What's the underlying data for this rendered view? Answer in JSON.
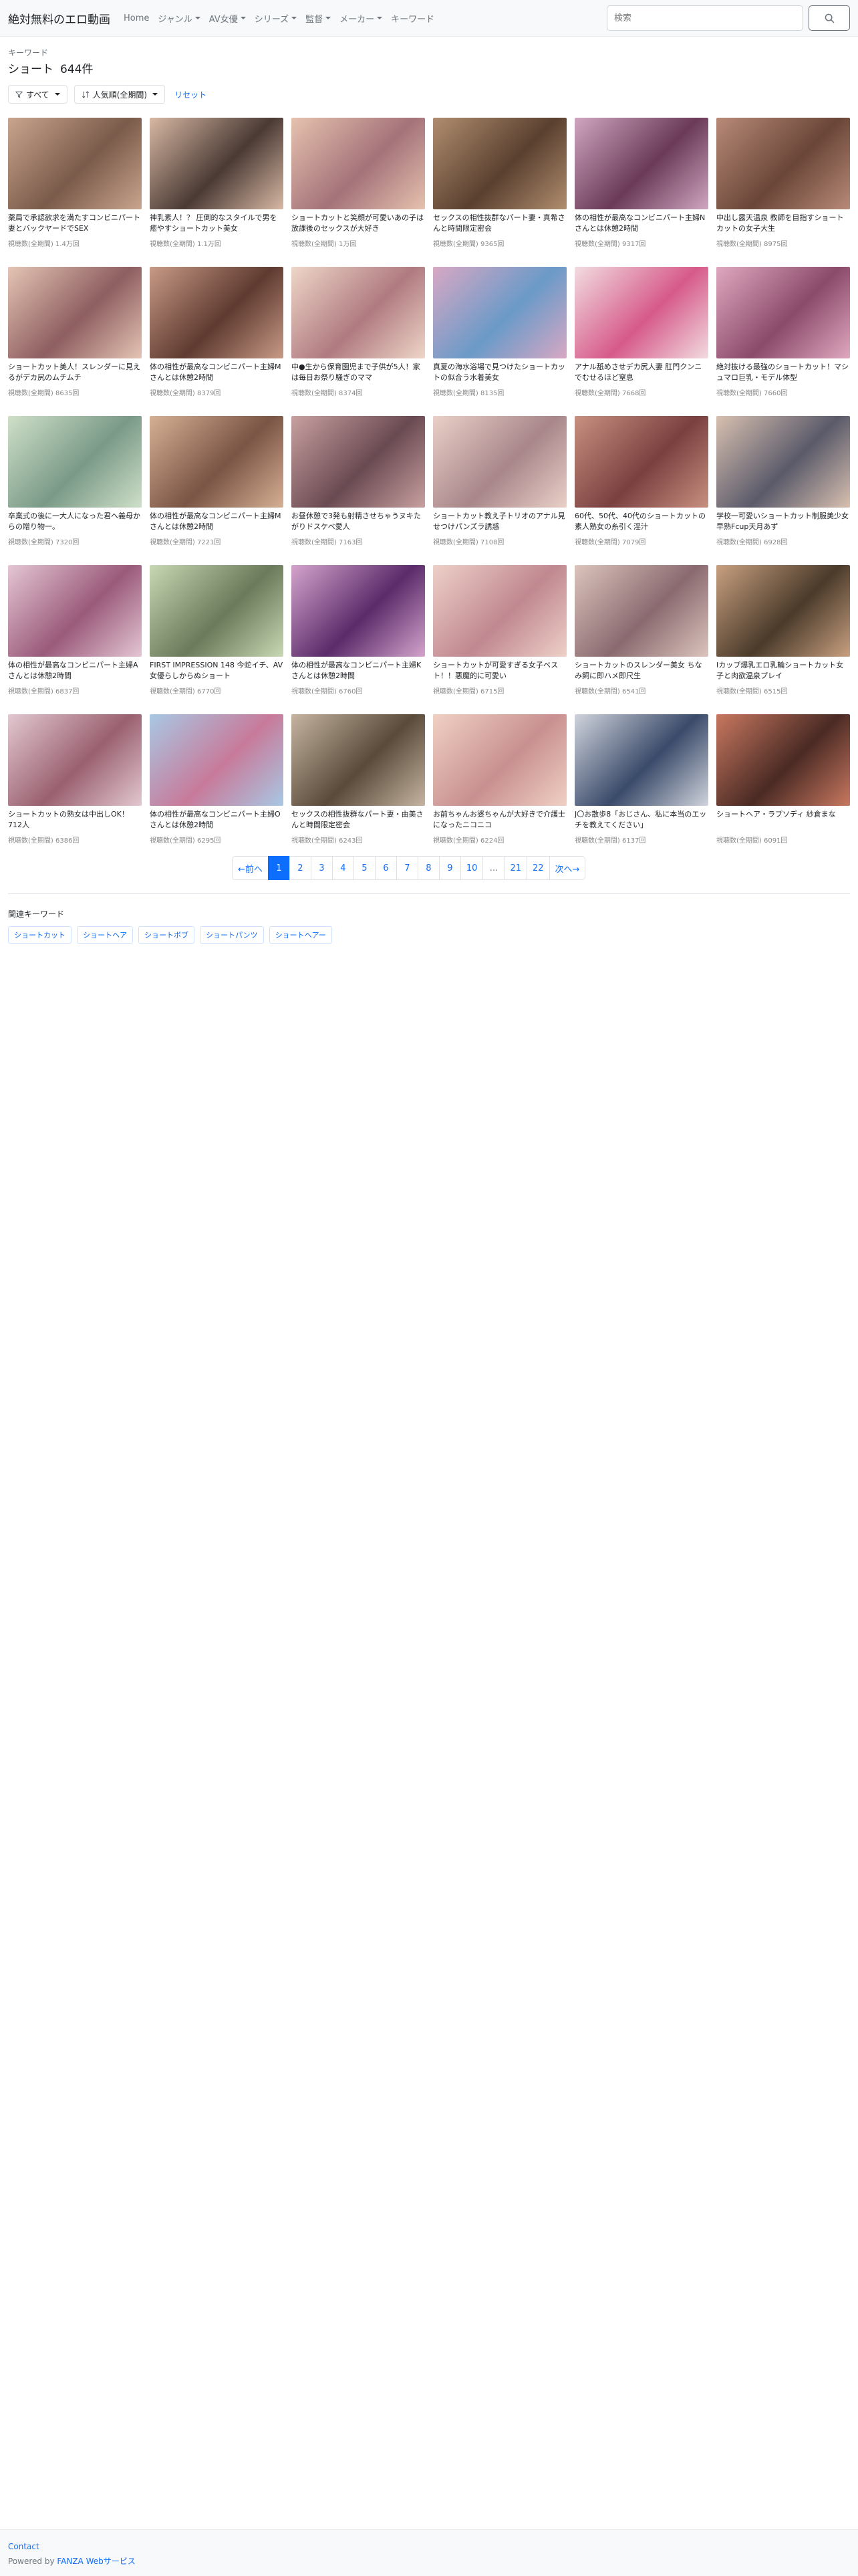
{
  "navbar": {
    "brand": "絶対無料のエロ動画",
    "items": [
      {
        "label": "Home",
        "dropdown": false
      },
      {
        "label": "ジャンル",
        "dropdown": true
      },
      {
        "label": "AV女優",
        "dropdown": true
      },
      {
        "label": "シリーズ",
        "dropdown": true
      },
      {
        "label": "監督",
        "dropdown": true
      },
      {
        "label": "メーカー",
        "dropdown": true
      },
      {
        "label": "キーワード",
        "dropdown": false
      }
    ],
    "search_placeholder": "検索"
  },
  "header": {
    "label": "キーワード",
    "title": "ショート",
    "count": "644件"
  },
  "filters": {
    "all_label": "すべて",
    "sort_label": "人気順(全期間)",
    "reset_label": "リセット"
  },
  "videos": [
    {
      "title": "薬局で承認欲求を満たすコンビニパート妻とバックヤードでSEX",
      "views": "視聴数(全期間) 1.4万回",
      "colors": [
        "#c9a58e",
        "#7a5a4a"
      ]
    },
    {
      "title": "神乳素人！？ 圧倒的なスタイルで男を癒やすショートカット美女",
      "views": "視聴数(全期間) 1.1万回",
      "colors": [
        "#d8b8a4",
        "#4a3a34"
      ]
    },
    {
      "title": "ショートカットと笑顔が可愛いあの子は放課後のセックスが大好き",
      "views": "視聴数(全期間) 1万回",
      "colors": [
        "#e6c2ae",
        "#a4727a"
      ]
    },
    {
      "title": "セックスの相性抜群なパート妻・真希さんと時間限定密会",
      "views": "視聴数(全期間) 9365回",
      "colors": [
        "#b08d6e",
        "#5a4030"
      ]
    },
    {
      "title": "体の相性が最高なコンビニパート主婦Nさんとは休憩2時間",
      "views": "視聴数(全期間) 9317回",
      "colors": [
        "#cfa6c0",
        "#6a3a58"
      ]
    },
    {
      "title": "中出し露天温泉 教師を目指すショートカットの女子大生",
      "views": "視聴数(全期間) 8975回",
      "colors": [
        "#b88a78",
        "#6a4638"
      ]
    },
    {
      "title": "ショートカット美人！スレンダーに見えるがデカ尻のムチムチ",
      "views": "視聴数(全期間) 8635回",
      "colors": [
        "#e4c4b4",
        "#8e5e60"
      ]
    },
    {
      "title": "体の相性が最高なコンビニパート主婦Mさんとは休憩2時間",
      "views": "視聴数(全期間) 8379回",
      "colors": [
        "#c89a86",
        "#5e3a30"
      ]
    },
    {
      "title": "中●生から保育園児まで子供が5人！家は毎日お祭り騒ぎのママ",
      "views": "視聴数(全期間) 8374回",
      "colors": [
        "#eed6c8",
        "#b07a80"
      ]
    },
    {
      "title": "真夏の海水浴場で見つけたショートカットの似合う水着美女",
      "views": "視聴数(全期間) 8135回",
      "colors": [
        "#d8a8c4",
        "#6a9ac8"
      ]
    },
    {
      "title": "アナル舐めさせデカ尻人妻 肛門クンニでむせるほど窒息",
      "views": "視聴数(全期間) 7668回",
      "colors": [
        "#f2dce0",
        "#d65a8a"
      ]
    },
    {
      "title": "絶対抜ける最強のショートカット！マシュマロ巨乳・モデル体型",
      "views": "視聴数(全期間) 7660回",
      "colors": [
        "#e0a8c0",
        "#8a4a6a"
      ]
    },
    {
      "title": "卒業式の後に一大人になった君へ義母からの贈り物一。",
      "views": "視聴数(全期間) 7320回",
      "colors": [
        "#cfe0c8",
        "#7a9a88"
      ]
    },
    {
      "title": "体の相性が最高なコンビニパート主婦Mさんとは休憩2時間",
      "views": "視聴数(全期間) 7221回",
      "colors": [
        "#d6b094",
        "#7a5444"
      ]
    },
    {
      "title": "お昼休憩で3発も射精させちゃうヌキたがりドスケベ愛人",
      "views": "視聴数(全期間) 7163回",
      "colors": [
        "#c8a0a0",
        "#6a4a52"
      ]
    },
    {
      "title": "ショートカット教え子トリオのアナル見せつけパンズラ誘惑",
      "views": "視聴数(全期間) 7108回",
      "colors": [
        "#ead0c8",
        "#a8868a"
      ]
    },
    {
      "title": "60代、50代、40代のショートカットの素人熟女の糸引く淫汁",
      "views": "視聴数(全期間) 7079回",
      "colors": [
        "#c89080",
        "#7a4040"
      ]
    },
    {
      "title": "学校一可愛いショートカット制服美少女 早熟Fcup天月あず",
      "views": "視聴数(全期間) 6928回",
      "colors": [
        "#d8c0b0",
        "#5a5a6a"
      ]
    },
    {
      "title": "体の相性が最高なコンビニパート主婦Aさんとは休憩2時間",
      "views": "視聴数(全期間) 6837回",
      "colors": [
        "#e4c6d4",
        "#9a5a7a"
      ]
    },
    {
      "title": "FIRST IMPRESSION 148 今蛇イチ、AV女優らしからぬショート",
      "views": "視聴数(全期間) 6770回",
      "colors": [
        "#c8d8b4",
        "#6a7a5a"
      ]
    },
    {
      "title": "体の相性が最高なコンビニパート主婦Kさんとは休憩2時間",
      "views": "視聴数(全期間) 6760回",
      "colors": [
        "#d4a4cc",
        "#5a2a6a"
      ]
    },
    {
      "title": "ショートカットが可愛すぎる女子ベスト！！悪魔的に可愛い",
      "views": "視聴数(全期間) 6715回",
      "colors": [
        "#eed0c8",
        "#c08890"
      ]
    },
    {
      "title": "ショートカットのスレンダー美女 ちなみ飼に即ハメ即尺生",
      "views": "視聴数(全期間) 6541回",
      "colors": [
        "#dcc4bc",
        "#8a6a70"
      ]
    },
    {
      "title": "Iカップ爆乳エロ乳輪ショートカット女子と肉欲温泉プレイ",
      "views": "視聴数(全期間) 6515回",
      "colors": [
        "#c8a080",
        "#4a3a2a"
      ]
    },
    {
      "title": "ショートカットの熟女は中出しOK！ 712人",
      "views": "視聴数(全期間) 6386回",
      "colors": [
        "#e2c8d0",
        "#9a6070"
      ]
    },
    {
      "title": "体の相性が最高なコンビニパート主婦Oさんとは休憩2時間",
      "views": "視聴数(全期間) 6295回",
      "colors": [
        "#a8c8e4",
        "#c87a9a"
      ]
    },
    {
      "title": "セックスの相性抜群なパート妻・由美さんと時間限定密会",
      "views": "視聴数(全期間) 6243回",
      "colors": [
        "#c4b4a0",
        "#5a4a3a"
      ]
    },
    {
      "title": "お前ちゃんお婆ちゃんが大好きで介護士になったニコニコ",
      "views": "視聴数(全期間) 6224回",
      "colors": [
        "#f0d0c4",
        "#c89090"
      ]
    },
    {
      "title": "J〇お散歩8「おじさん、私に本当のエッチを教えてください」",
      "views": "視聴数(全期間) 6137回",
      "colors": [
        "#d0d4dc",
        "#3a4a6a"
      ]
    },
    {
      "title": "ショートヘア・ラプソディ 紗倉まな",
      "views": "視聴数(全期間) 6091回",
      "colors": [
        "#c87860",
        "#4a2a24"
      ]
    }
  ],
  "pagination": {
    "prev": "←前へ",
    "next": "次へ→",
    "pages": [
      "1",
      "2",
      "3",
      "4",
      "5",
      "6",
      "7",
      "8",
      "9",
      "10",
      "...",
      "21",
      "22"
    ],
    "active": "1"
  },
  "related": {
    "title": "関連キーワード",
    "tags": [
      "ショートカット",
      "ショートヘア",
      "ショートボブ",
      "ショートパンツ",
      "ショートヘアー"
    ]
  },
  "footer": {
    "contact": "Contact",
    "powered_prefix": "Powered by ",
    "powered_link": "FANZA Webサービス"
  }
}
